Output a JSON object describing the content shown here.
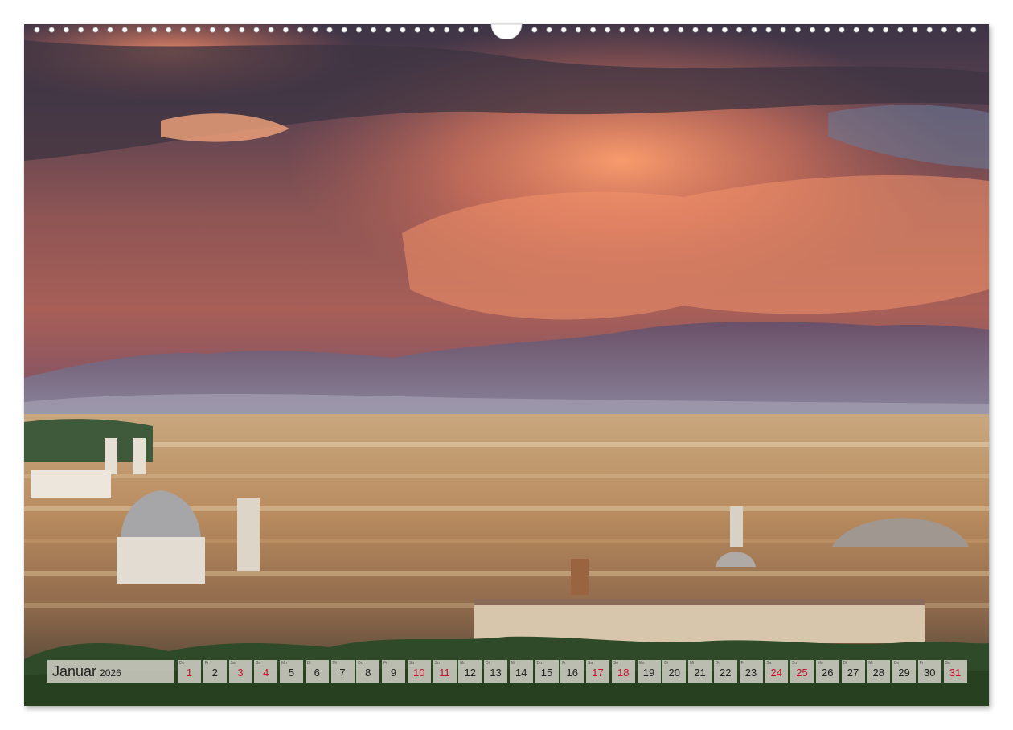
{
  "calendar": {
    "month": "Januar",
    "year": "2026",
    "weekend_color": "#c8102e",
    "days": [
      {
        "n": "1",
        "dow": "Do",
        "weekend": true
      },
      {
        "n": "2",
        "dow": "Fr",
        "weekend": false
      },
      {
        "n": "3",
        "dow": "Sa",
        "weekend": true
      },
      {
        "n": "4",
        "dow": "So",
        "weekend": true
      },
      {
        "n": "5",
        "dow": "Mo",
        "weekend": false
      },
      {
        "n": "6",
        "dow": "Di",
        "weekend": false
      },
      {
        "n": "7",
        "dow": "Mi",
        "weekend": false
      },
      {
        "n": "8",
        "dow": "Do",
        "weekend": false
      },
      {
        "n": "9",
        "dow": "Fr",
        "weekend": false
      },
      {
        "n": "10",
        "dow": "Sa",
        "weekend": true
      },
      {
        "n": "11",
        "dow": "So",
        "weekend": true
      },
      {
        "n": "12",
        "dow": "Mo",
        "weekend": false
      },
      {
        "n": "13",
        "dow": "Di",
        "weekend": false
      },
      {
        "n": "14",
        "dow": "Mi",
        "weekend": false
      },
      {
        "n": "15",
        "dow": "Do",
        "weekend": false
      },
      {
        "n": "16",
        "dow": "Fr",
        "weekend": false
      },
      {
        "n": "17",
        "dow": "Sa",
        "weekend": true
      },
      {
        "n": "18",
        "dow": "So",
        "weekend": true
      },
      {
        "n": "19",
        "dow": "Mo",
        "weekend": false
      },
      {
        "n": "20",
        "dow": "Di",
        "weekend": false
      },
      {
        "n": "21",
        "dow": "Mi",
        "weekend": false
      },
      {
        "n": "22",
        "dow": "Do",
        "weekend": false
      },
      {
        "n": "23",
        "dow": "Fr",
        "weekend": false
      },
      {
        "n": "24",
        "dow": "Sa",
        "weekend": true
      },
      {
        "n": "25",
        "dow": "So",
        "weekend": true
      },
      {
        "n": "26",
        "dow": "Mo",
        "weekend": false
      },
      {
        "n": "27",
        "dow": "Di",
        "weekend": false
      },
      {
        "n": "28",
        "dow": "Mi",
        "weekend": false
      },
      {
        "n": "29",
        "dow": "Do",
        "weekend": false
      },
      {
        "n": "30",
        "dow": "Fr",
        "weekend": false
      },
      {
        "n": "31",
        "dow": "Sa",
        "weekend": true
      }
    ]
  }
}
